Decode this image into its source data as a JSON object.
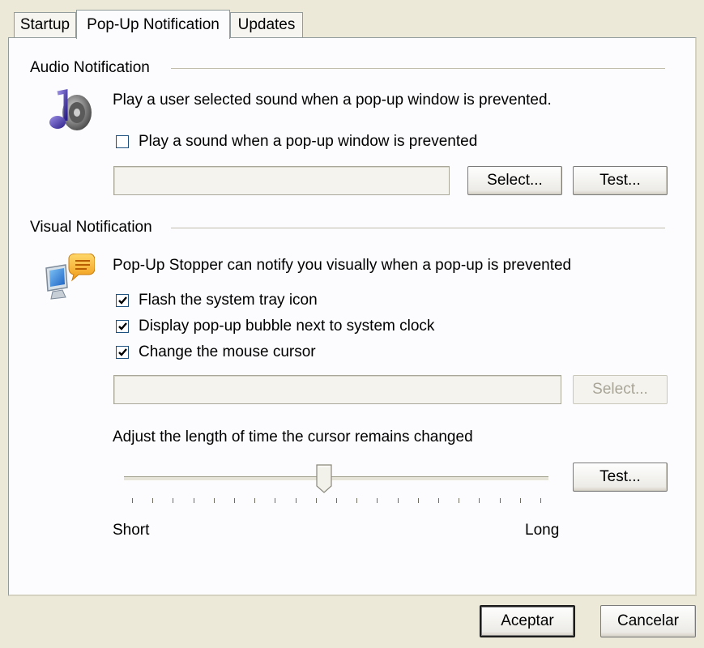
{
  "tabs": [
    {
      "label": "Startup",
      "active": false
    },
    {
      "label": "Pop-Up Notification",
      "active": true
    },
    {
      "label": "Updates",
      "active": false
    }
  ],
  "audio": {
    "group_label": "Audio Notification",
    "icon": "speaker-music-icon",
    "description": "Play a user selected sound when a pop-up window is prevented.",
    "checkbox_label": "Play a sound when a pop-up window is prevented",
    "checkbox_checked": false,
    "sound_path": "",
    "select_label": "Select...",
    "test_label": "Test..."
  },
  "visual": {
    "group_label": "Visual Notification",
    "icon": "monitor-speech-bubble-icon",
    "description": "Pop-Up Stopper can notify you visually when a pop-up is prevented",
    "options": [
      {
        "label": "Flash the system tray icon",
        "checked": true
      },
      {
        "label": "Display pop-up bubble next to system clock",
        "checked": true
      },
      {
        "label": "Change the mouse cursor",
        "checked": true
      }
    ],
    "cursor_path": "",
    "select_label": "Select...",
    "select_disabled": true,
    "slider_caption": "Adjust the length of time the cursor remains changed",
    "slider_value_fraction": 0.47,
    "slider_min_label": "Short",
    "slider_max_label": "Long",
    "test_label": "Test..."
  },
  "dialog_buttons": {
    "ok_label": "Aceptar",
    "cancel_label": "Cancelar"
  }
}
